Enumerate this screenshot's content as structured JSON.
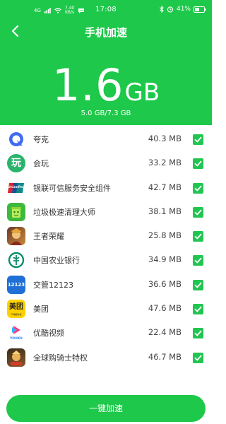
{
  "status_bar": {
    "network": "4G",
    "speed_value": "7.40",
    "speed_unit": "KB/s",
    "time": "17:08",
    "battery": "41%"
  },
  "header": {
    "title": "手机加速",
    "memory_value": "1.6",
    "memory_unit": "GB",
    "memory_detail": "5.0 GB/7.3 GB"
  },
  "apps": [
    {
      "name": "夸克",
      "size": "40.3 MB",
      "checked": true
    },
    {
      "name": "会玩",
      "size": "33.2 MB",
      "checked": true
    },
    {
      "name": "银联可信服务安全组件",
      "size": "42.7 MB",
      "checked": true
    },
    {
      "name": "垃圾极速清理大师",
      "size": "38.1 MB",
      "checked": true
    },
    {
      "name": "王者荣耀",
      "size": "25.8 MB",
      "checked": true
    },
    {
      "name": "中国农业银行",
      "size": "34.9 MB",
      "checked": true
    },
    {
      "name": "交管12123",
      "size": "36.6 MB",
      "checked": true
    },
    {
      "name": "美团",
      "size": "47.6 MB",
      "checked": true
    },
    {
      "name": "优酷视频",
      "size": "22.4 MB",
      "checked": true
    },
    {
      "name": "全球购骑士特权",
      "size": "46.7 MB",
      "checked": true
    }
  ],
  "icon_text": {
    "huiwan": "玩",
    "unionpay": "UnionPay",
    "jiaoguan": "12123",
    "meituan": "美团",
    "meituan_sub": "干啥都省钱",
    "youku": "YOUKU"
  },
  "footer": {
    "boost_label": "一键加速"
  },
  "colors": {
    "accent": "#1ec84a",
    "check": "#22c552"
  }
}
